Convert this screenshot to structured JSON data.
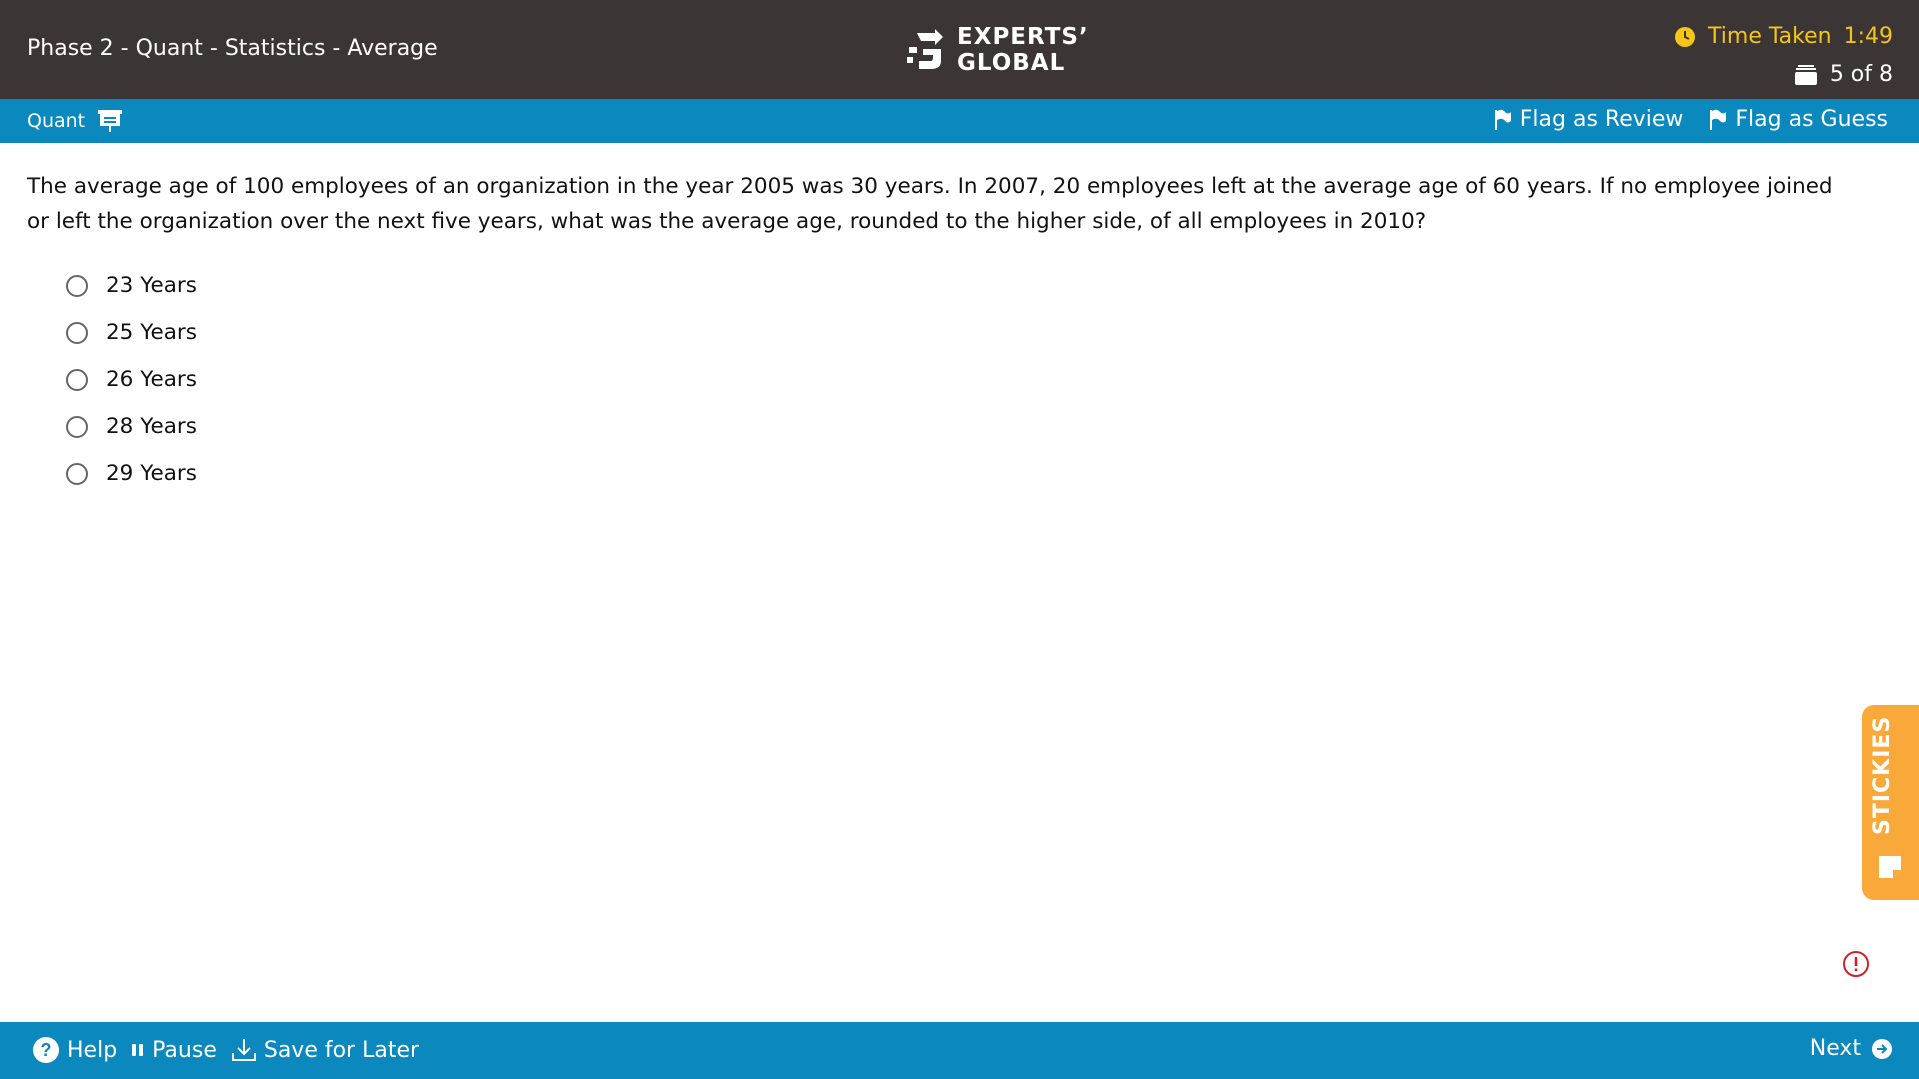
{
  "header": {
    "breadcrumb": "Phase 2 - Quant - Statistics - Average",
    "logo_line1": "EXPERTS’",
    "logo_line2": "GLOBAL",
    "timer_label": "Time Taken",
    "timer_value": "1:49",
    "progress_text": "5 of 8",
    "timer_color": "#f5c518"
  },
  "subbar": {
    "section_label": "Quant",
    "section_icon": "presentation-board-icon",
    "flag_review": "Flag as Review",
    "flag_guess": "Flag as Guess",
    "color": "#0b89bf"
  },
  "question": {
    "text": "The average age of 100 employees of an organization in the year 2005 was 30 years. In 2007, 20 employees left at the average age of 60 years. If no employee joined or left the organization over the next five years, what was the average age, rounded to the higher side, of all employees in 2010?",
    "options": [
      {
        "label": "23 Years",
        "selected": false
      },
      {
        "label": "25 Years",
        "selected": false
      },
      {
        "label": "26 Years",
        "selected": false
      },
      {
        "label": "28 Years",
        "selected": false
      },
      {
        "label": "29 Years",
        "selected": false
      }
    ]
  },
  "stickies": {
    "label": "STICKIES",
    "color": "#f8a93a"
  },
  "footer": {
    "help": "Help",
    "pause": "Pause",
    "save_later": "Save for Later",
    "next": "Next"
  }
}
